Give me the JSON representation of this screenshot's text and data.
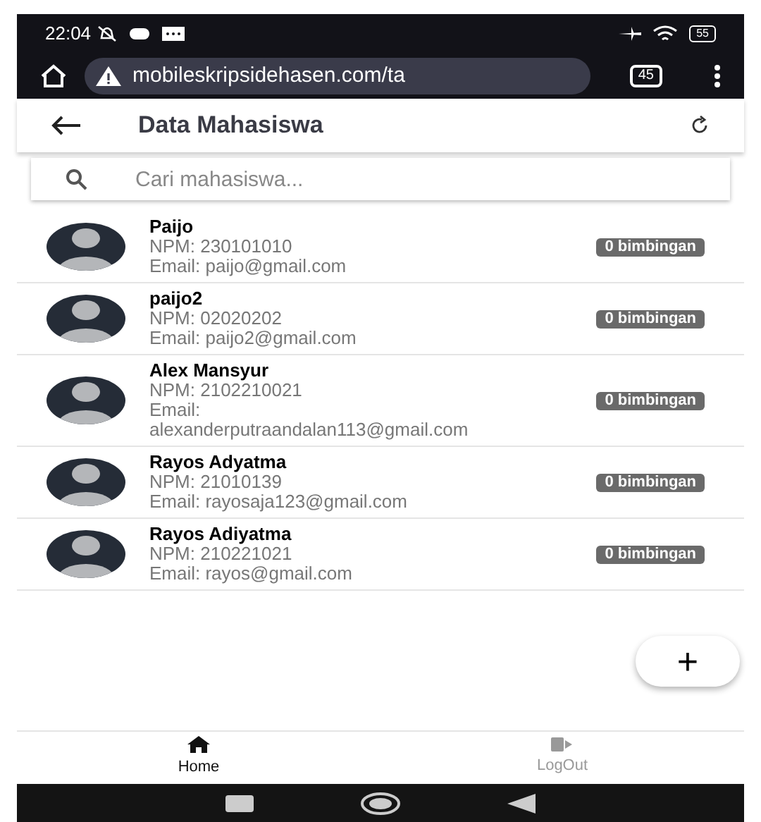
{
  "status_bar": {
    "time": "22:04",
    "battery": "55"
  },
  "browser": {
    "url": "mobileskripsidehasen.com/ta",
    "tab_count": "45"
  },
  "header": {
    "title": "Data Mahasiswa"
  },
  "search": {
    "placeholder": "Cari mahasiswa..."
  },
  "students": [
    {
      "name": "Paijo",
      "npm": "NPM: 230101010",
      "email": "Email: paijo@gmail.com",
      "badge": "0 bimbingan"
    },
    {
      "name": "paijo2",
      "npm": "NPM: 02020202",
      "email": "Email: paijo2@gmail.com",
      "badge": "0 bimbingan"
    },
    {
      "name": "Alex Mansyur",
      "npm": "NPM: 2102210021",
      "email": "Email: alexanderputraandalan113@gmail.com",
      "badge": "0 bimbingan"
    },
    {
      "name": "Rayos Adyatma",
      "npm": "NPM: 21010139",
      "email": "Email: rayosaja123@gmail.com",
      "badge": "0 bimbingan"
    },
    {
      "name": "Rayos Adiyatma",
      "npm": "NPM: 210221021",
      "email": "Email: rayos@gmail.com",
      "badge": "0 bimbingan"
    }
  ],
  "fab": {
    "label": "+"
  },
  "bottom_nav": [
    {
      "kind": "home",
      "label": "Home",
      "selected": true
    },
    {
      "kind": "logout",
      "label": "LogOut",
      "selected": false
    }
  ]
}
